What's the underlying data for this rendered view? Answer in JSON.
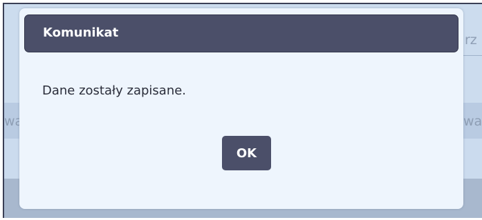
{
  "background": {
    "fragment_top_right": "rz",
    "fragment_left": "wa",
    "fragment_right": "wa"
  },
  "dialog": {
    "title": "Komunikat",
    "message": "Dane zostały zapisane.",
    "ok_label": "OK"
  },
  "colors": {
    "header_bg": "#4b4f69",
    "dialog_bg": "#eef5fd",
    "button_bg": "#4b4f69",
    "page_bg": "#c6d6ea"
  }
}
